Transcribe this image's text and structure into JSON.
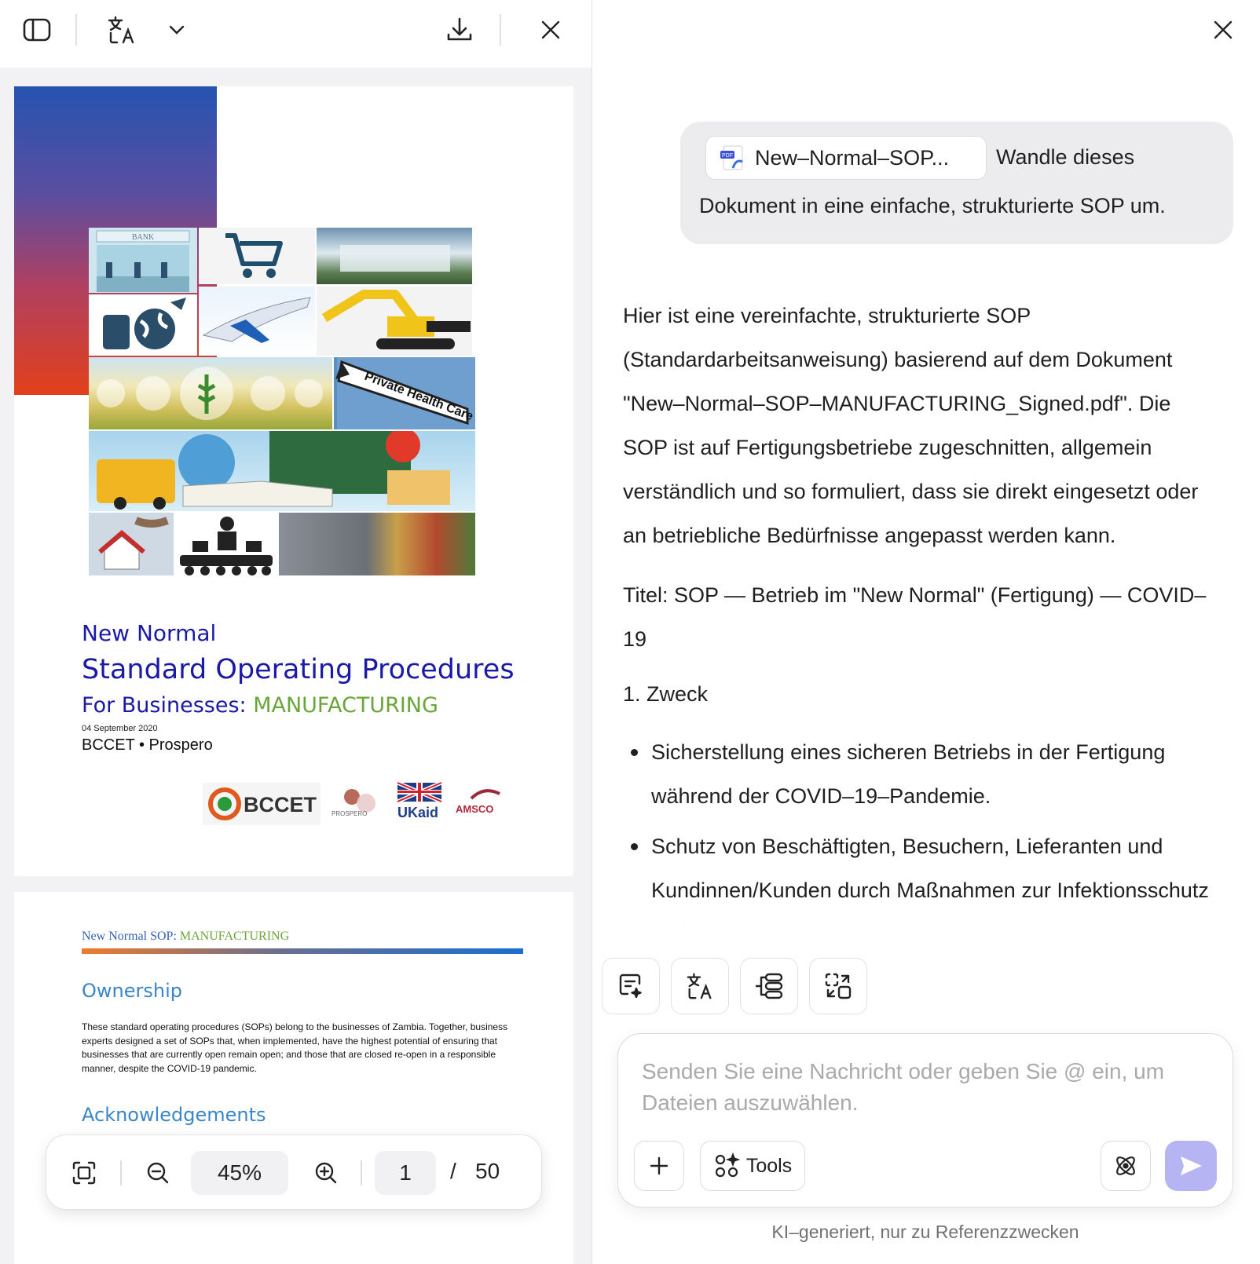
{
  "left_toolbar": {
    "icons": [
      "sidebar-toggle-icon",
      "translate-icon",
      "chevron-down-icon",
      "download-icon",
      "close-icon"
    ]
  },
  "document": {
    "cover": {
      "title_line1": "New Normal",
      "title_line2": "Standard Operating Procedures",
      "title_line3_prefix": "For Businesses: ",
      "title_line3_accent": "MANUFACTURING",
      "date": "04 September 2020",
      "orgs": "BCCET • Prospero",
      "collage_tiles": {
        "bank_sign": "BANK",
        "health_sign": "Private Health Care"
      },
      "logos": {
        "bccet": "BCCET",
        "prospero": "PROSPERO",
        "ukaid": "UKaid",
        "amsco": "AMSCO"
      }
    },
    "page2": {
      "header_prefix": "New Normal SOP: ",
      "header_accent": "MANUFACTURING",
      "section1_title": "Ownership",
      "section1_text": "These standard operating procedures (SOPs) belong to the businesses of Zambia. Together, business experts designed a set of SOPs that, when implemented, have the highest potential of ensuring that businesses that are currently open remain open; and those that are closed re-open in a responsible manner, despite the COVID-19 pandemic.",
      "section2_title": "Acknowledgements"
    }
  },
  "zoom_bar": {
    "zoom": "45%",
    "page_current": "1",
    "page_separator": "/",
    "page_total": "50"
  },
  "chat": {
    "user_message": {
      "file_name": "New–Normal–SOP...",
      "text_line1": "Wandle dieses",
      "text_line2": "Dokument in eine einfache, strukturierte SOP um."
    },
    "ai_response": {
      "intro": "Hier ist eine vereinfachte, strukturierte SOP (Standardarbeitsanweisung) basierend auf dem Dokument \"New–Normal–SOP–MANUFACTURING_Signed.pdf\". Die SOP ist auf Fertigungsbetriebe zugeschnitten, allgemein verständlich und so formuliert, dass sie direkt eingesetzt oder an betriebliche Bedürfnisse angepasst werden kann.",
      "title": "Titel: SOP — Betrieb im \"New Normal\" (Fertigung) — COVID–19",
      "section_heading": "1. Zweck",
      "bullets": [
        "Sicherstellung eines sicheren Betriebs in der Fertigung während der COVID–19–Pandemie.",
        "Schutz von Beschäftigten, Besuchern, Lieferanten und Kundinnen/Kunden durch Maßnahmen zur Infektionsschutz und Fortführung des"
      ]
    },
    "quick_actions": [
      "summarize-icon",
      "translate-icon",
      "mindmap-icon",
      "convert-icon"
    ],
    "composer": {
      "placeholder": "Senden Sie eine Nachricht oder geben Sie @ ein, um Dateien auszuwählen.",
      "tools_label": "Tools"
    },
    "disclaimer": "KI–generiert, nur zu Referenzzwecken"
  },
  "colors": {
    "accent_send": "#b7b4f4",
    "doc_title_blue": "#1a1aa6",
    "doc_accent_green": "#6aa53a",
    "doc_heading_blue": "#3a86c9"
  }
}
